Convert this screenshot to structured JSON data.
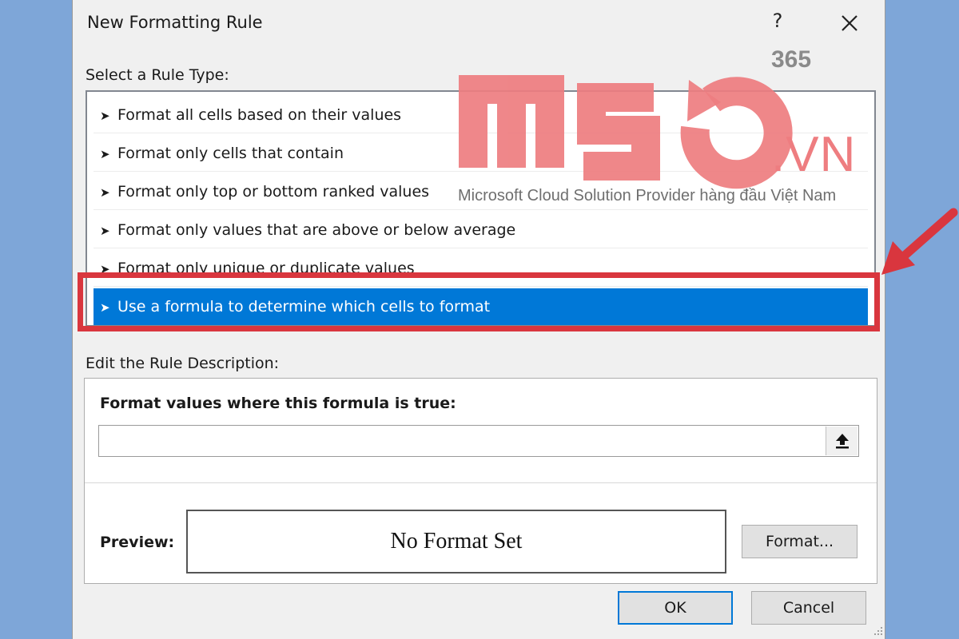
{
  "dialog": {
    "title": "New Formatting Rule",
    "help_label": "?",
    "close_icon": "close-icon"
  },
  "rule_type": {
    "label": "Select a Rule Type:",
    "items": [
      "Format all cells based on their values",
      "Format only cells that contain",
      "Format only top or bottom ranked values",
      "Format only values that are above or below average",
      "Format only unique or duplicate values",
      "Use a formula to determine which cells to format"
    ],
    "selected_index": 5,
    "bullet": "➤"
  },
  "rule_description": {
    "label": "Edit the Rule Description:",
    "formula_label": "Format values where this formula is true:",
    "formula_value": "",
    "collapse_icon": "upload-arrow-icon",
    "preview_label": "Preview:",
    "preview_text": "No Format Set",
    "format_button": "Format..."
  },
  "footer": {
    "ok_button": "OK",
    "cancel_button": "Cancel"
  },
  "watermark": {
    "logo_text": "MSO",
    "suffix": "365",
    "domain": ".VN",
    "tagline": "Microsoft Cloud Solution Provider hàng đầu Việt Nam"
  },
  "colors": {
    "background": "#7ea6d8",
    "selection": "#0078d7",
    "highlight": "#d9363e",
    "watermark": "#ee7d80"
  }
}
